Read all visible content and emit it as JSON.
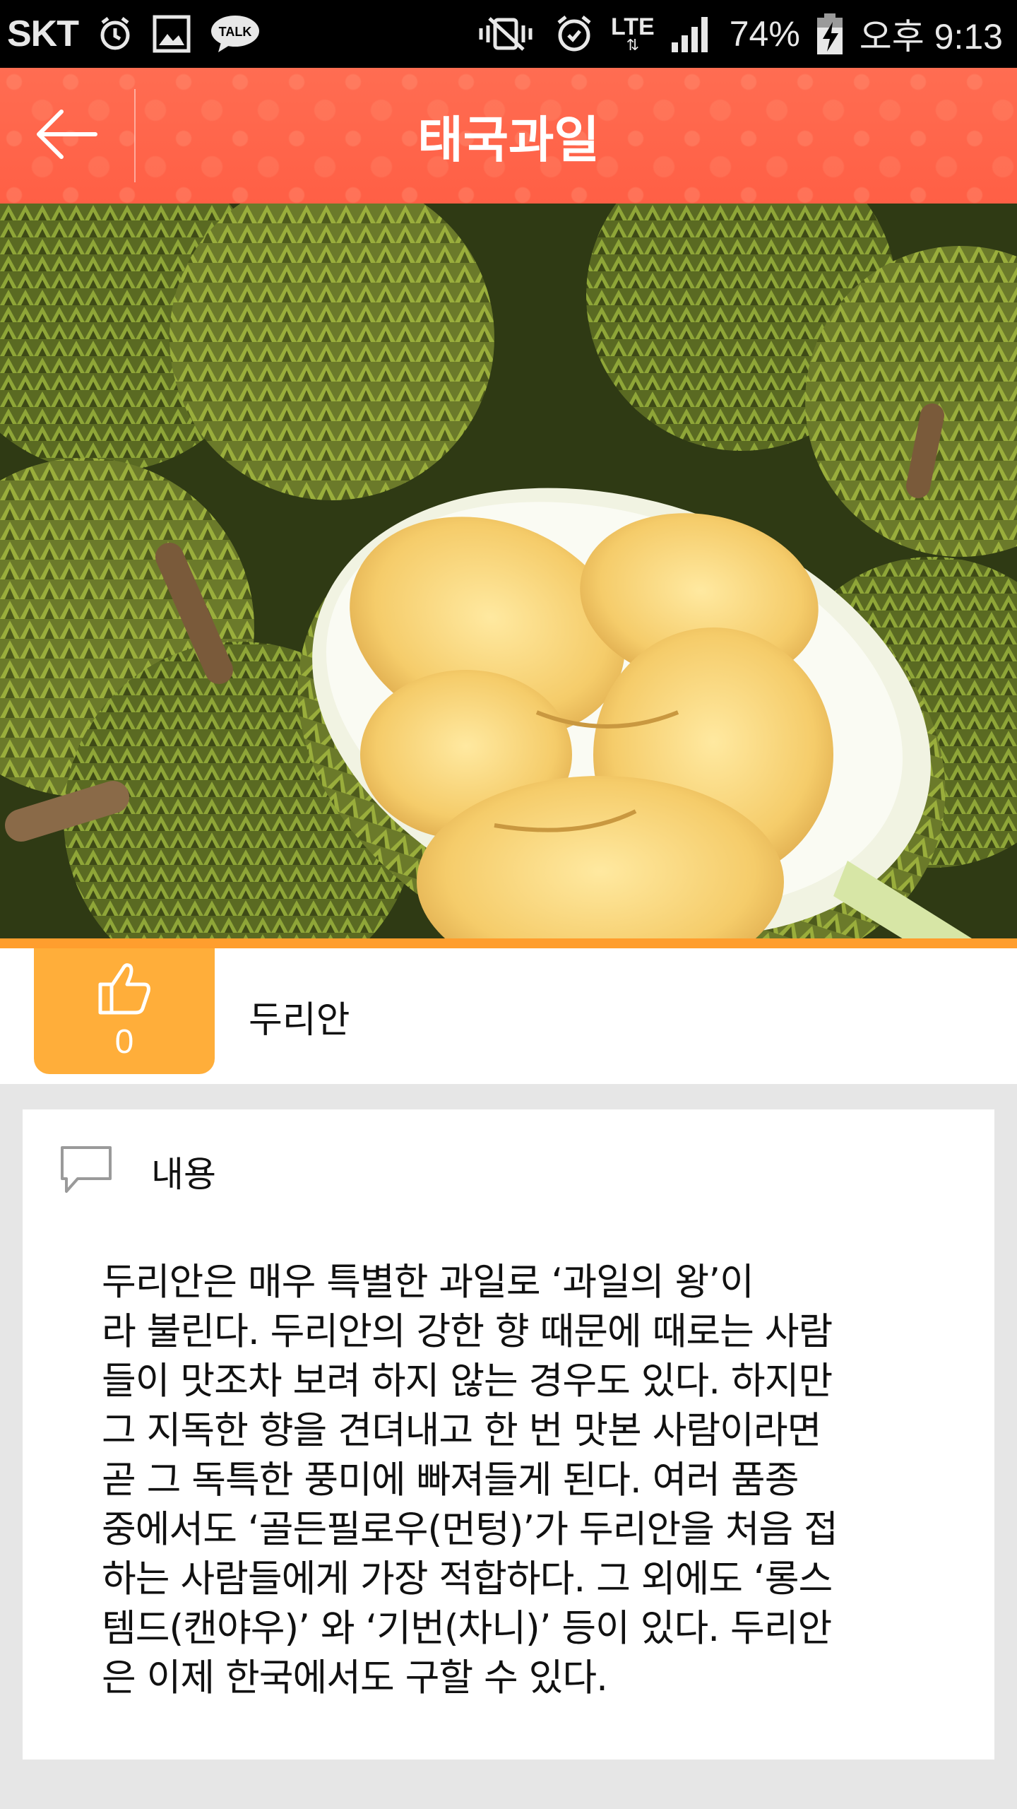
{
  "status_bar": {
    "carrier": "SKT",
    "network": "LTE",
    "battery": "74%",
    "time": "오후 9:13",
    "icons": [
      "alarm-icon",
      "gallery-icon",
      "kakaotalk-icon",
      "vibrate-icon",
      "alarm-clock-icon",
      "lte-icon",
      "signal-icon",
      "battery-charging-icon"
    ],
    "talk_label": "TALK"
  },
  "header": {
    "title": "태국과일",
    "background_color": "#ff6a4e"
  },
  "hero": {
    "icon": "durian-photo"
  },
  "item": {
    "name": "두리안",
    "like_count": "0",
    "like_color": "#ffae3a"
  },
  "content": {
    "label": "내용",
    "body": "두리안은 매우 특별한 과일로 ‘과일의 왕’이\n라 불린다. 두리안의 강한 향 때문에 때로는 사람\n들이 맛조차 보려 하지 않는 경우도 있다. 하지만\n그 지독한 향을 견뎌내고 한 번 맛본 사람이라면\n곧 그 독특한 풍미에 빠져들게 된다. 여러 품종\n중에서도 ‘골든필로우(먼텅)’가 두리안을 처음 접\n하는 사람들에게 가장 적합하다. 그 외에도 ‘롱스\n템드(캔야우)’ 와 ‘기번(차니)’ 등이 있다. 두리안\n은 이제 한국에서도 구할 수 있다."
  }
}
